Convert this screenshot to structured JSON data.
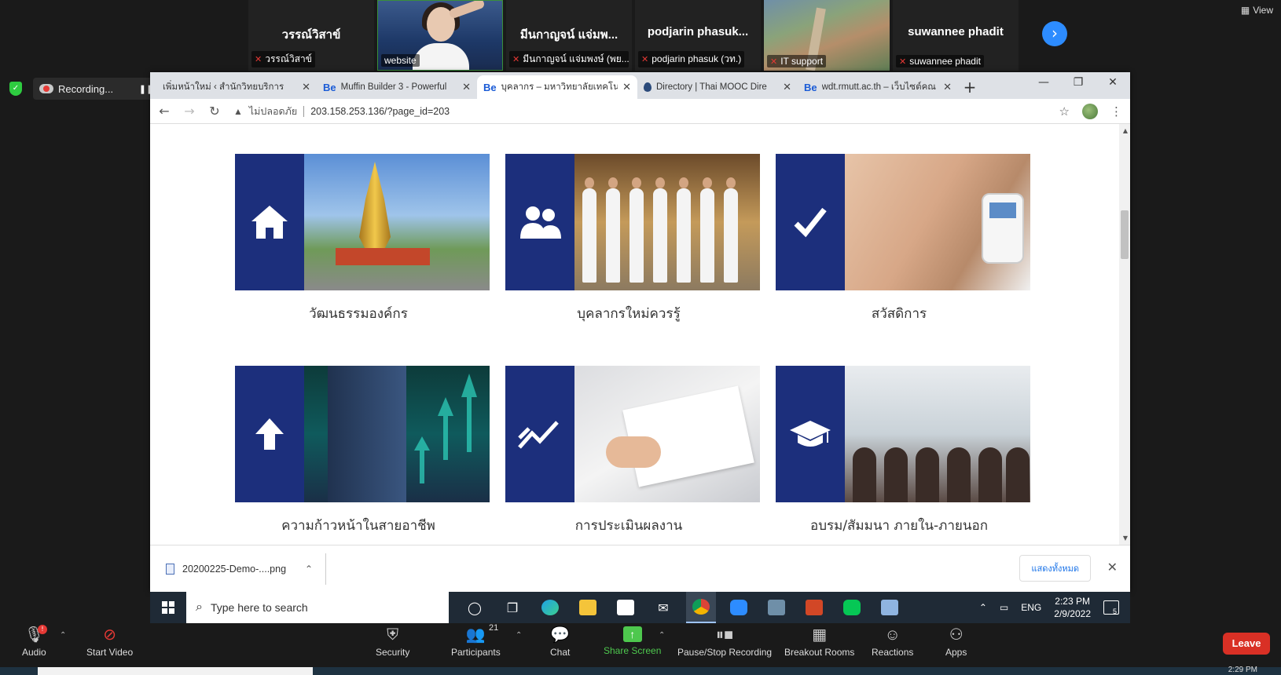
{
  "gallery": {
    "tiles": [
      {
        "kind": "name",
        "name": "วรรณ์วิสาข์",
        "label": "วรรณ์วิสาข์",
        "muted": true
      },
      {
        "kind": "video-person",
        "name": "",
        "label": "website",
        "muted": false
      },
      {
        "kind": "name",
        "name": "มีนกาญจน์ แจ่มพ...",
        "label": "มีนกาญจน์ แจ่มพงษ์ (พย...",
        "muted": true
      },
      {
        "kind": "name",
        "name": "podjarin  phasuk...",
        "label": "podjarin phasuk (วท.)",
        "muted": true
      },
      {
        "kind": "video-aerial",
        "name": "",
        "label": "IT support",
        "muted": true
      },
      {
        "kind": "name",
        "name": "suwannee phadit",
        "label": "suwannee phadit",
        "muted": true
      }
    ],
    "next_icon": "chevron-right-icon",
    "view_label": "View"
  },
  "recording": {
    "label": "Recording..."
  },
  "browser": {
    "tabs": [
      {
        "label": "เพิ่มหน้าใหม่ ‹ สำนักวิทยบริการ",
        "favicon": "partial",
        "active": false
      },
      {
        "label": "Muffin Builder 3 - Powerful",
        "favicon": "Be",
        "active": false
      },
      {
        "label": "บุคลากร – มหาวิทยาลัยเทคโนโล",
        "favicon": "Be",
        "active": true
      },
      {
        "label": "Directory | Thai MOOC Dire",
        "favicon": "drop",
        "active": false
      },
      {
        "label": "wdt.rmutt.ac.th – เว็บไซต์คณ",
        "favicon": "Be",
        "active": false
      }
    ],
    "address": {
      "insecure_label": "ไม่ปลอดภัย",
      "url": "203.158.253.136/?page_id=203"
    }
  },
  "cards": [
    {
      "label": "วัฒนธรรมองค์กร",
      "icon": "home-icon",
      "photo": "monument"
    },
    {
      "label": "บุคลากรใหม่ควรรู้",
      "icon": "users-icon",
      "photo": "people"
    },
    {
      "label": "สวัสดิการ",
      "icon": "check-icon",
      "photo": "health"
    },
    {
      "label": "ความก้าวหน้าในสายอาชีพ",
      "icon": "arrow-up-icon",
      "photo": "career"
    },
    {
      "label": "การประเมินผลงาน",
      "icon": "trend-icon",
      "photo": "eval"
    },
    {
      "label": "อบรม/สัมมนา ภายใน-ภายนอก",
      "icon": "graduation-cap-icon",
      "photo": "train"
    }
  ],
  "downloads": {
    "file": "20200225-Demo-....png",
    "show_all": "แสดงทั้งหมด"
  },
  "taskbar": {
    "search_placeholder": "Type here to search",
    "lang": "ENG",
    "time": "2:23 PM",
    "date": "2/9/2022",
    "notif_count": "5"
  },
  "zoom": {
    "audio": "Audio",
    "audio_badge": "!",
    "start_video": "Start Video",
    "security": "Security",
    "participants": "Participants",
    "participants_count": "21",
    "chat": "Chat",
    "share": "Share Screen",
    "pause_stop": "Pause/Stop Recording",
    "breakout": "Breakout Rooms",
    "reactions": "Reactions",
    "apps": "Apps",
    "leave": "Leave",
    "strip_time": "2:29 PM"
  },
  "colors": {
    "card_icon_bg": "#1c2f7c",
    "leave": "#d93025",
    "share_green": "#4ec84e",
    "zoom_blue": "#2d8cff"
  }
}
